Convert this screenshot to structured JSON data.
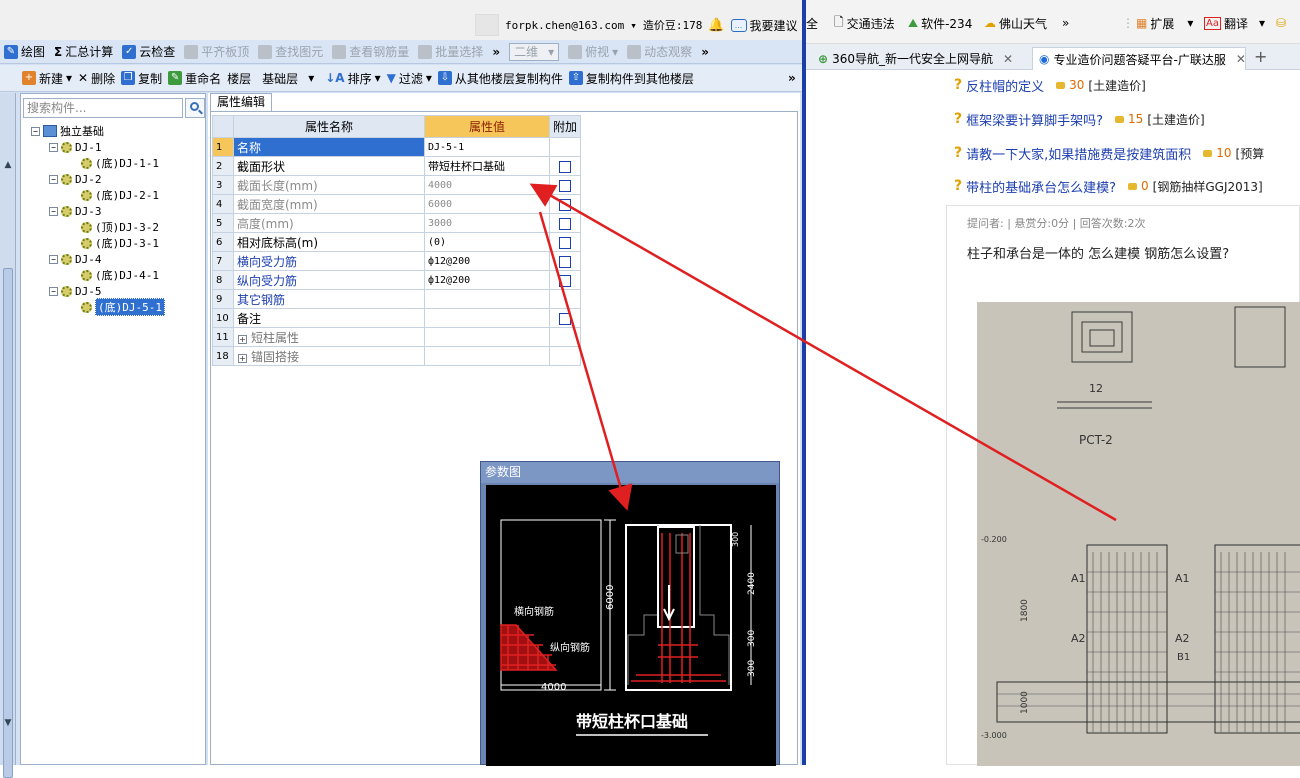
{
  "app": {
    "account": "forpk.chen@163.com",
    "beans": "造价豆:178",
    "suggest": "我要建议",
    "toolbar1": {
      "draw": "绘图",
      "sum_calc": "汇总计算",
      "cloud_check": "云检查",
      "flat_top": "平齐板顶",
      "find_element": "查找图元",
      "view_rebar": "查看钢筋量",
      "batch_select": "批量选择",
      "view_mode": "二维",
      "view_angle": "俯视",
      "dynamic": "动态观察"
    },
    "toolbar2": {
      "new": "新建",
      "delete": "删除",
      "copy": "复制",
      "rename": "重命名",
      "floor_label": "楼层",
      "floor_value": "基础层",
      "sort": "排序",
      "filter": "过滤",
      "copy_from": "从其他楼层复制构件",
      "copy_to": "复制构件到其他楼层"
    },
    "search_placeholder": "搜索构件...",
    "tree": {
      "root": "独立基础",
      "groups": [
        {
          "name": "DJ-1",
          "children": [
            "(底)DJ-1-1"
          ]
        },
        {
          "name": "DJ-2",
          "children": [
            "(底)DJ-2-1"
          ]
        },
        {
          "name": "DJ-3",
          "children": [
            "(顶)DJ-3-2",
            "(底)DJ-3-1"
          ]
        },
        {
          "name": "DJ-4",
          "children": [
            "(底)DJ-4-1"
          ]
        },
        {
          "name": "DJ-5",
          "children": [
            "(底)DJ-5-1"
          ]
        }
      ]
    },
    "prop_tab": "属性编辑",
    "prop_headers": {
      "name": "属性名称",
      "value": "属性值",
      "extra": "附加"
    },
    "props": [
      {
        "no": "1",
        "name": "名称",
        "value": "DJ-5-1"
      },
      {
        "no": "2",
        "name": "截面形状",
        "value": "带短柱杯口基础"
      },
      {
        "no": "3",
        "name": "截面长度(mm)",
        "value": "4000"
      },
      {
        "no": "4",
        "name": "截面宽度(mm)",
        "value": "6000"
      },
      {
        "no": "5",
        "name": "高度(mm)",
        "value": "3000"
      },
      {
        "no": "6",
        "name": "相对底标高(m)",
        "value": "(0)"
      },
      {
        "no": "7",
        "name": "横向受力筋",
        "value": "ф12@200"
      },
      {
        "no": "8",
        "name": "纵向受力筋",
        "value": "ф12@200"
      },
      {
        "no": "9",
        "name": "其它钢筋",
        "value": ""
      },
      {
        "no": "10",
        "name": "备注",
        "value": ""
      },
      {
        "no": "11",
        "name": "短柱属性",
        "value": ""
      },
      {
        "no": "18",
        "name": "锚固搭接",
        "value": ""
      }
    ],
    "param_window": {
      "title": "参数图",
      "caption": "带短柱杯口基础",
      "label_transverse": "横向钢筋",
      "label_longitudinal": "纵向钢筋",
      "dim_4000": "4000",
      "dim_6000": "6000",
      "dim_2400": "2400",
      "dim_300a": "300",
      "dim_300b": "300",
      "dim_top": "300"
    }
  },
  "browser": {
    "bookmarks": [
      "全",
      "交通违法",
      "软件-234",
      "佛山天气",
      "扩展",
      "翻译"
    ],
    "tabs": [
      "360导航_新一代安全上网导航",
      "专业造价问题答疑平台-广联达服"
    ],
    "questions": [
      {
        "title": "反柱帽的定义",
        "score": "30",
        "tag": "[土建造价]"
      },
      {
        "title": "框架梁要计算脚手架吗?",
        "score": "15",
        "tag": "[土建造价]"
      },
      {
        "title": "请教一下大家,如果措施费是按建筑面积",
        "score": "10",
        "tag": "[预算"
      },
      {
        "title": "带柱的基础承台怎么建模?",
        "score": "0",
        "tag": "[钢筋抽样GGJ2013]"
      }
    ],
    "meta": "提问者:   |  悬赏分:0分  |  回答次数:2次",
    "body": "柱子和承台是一体的 怎么建模 钢筋怎么设置?",
    "photo_labels": {
      "pct": "PCT-2",
      "dim_1800": "1800",
      "dim_1000": "1000",
      "a1": "A1",
      "a2": "A2",
      "b1": "B1",
      "elev1": "-0.200",
      "elev2": "-3.000",
      "num_12": "12"
    }
  },
  "colors": {
    "accent": "#2f6fd0",
    "arrow": "#e02020",
    "header_value": "#f6c65a"
  }
}
